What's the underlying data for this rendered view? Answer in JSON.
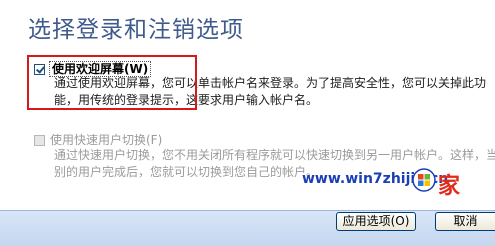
{
  "page": {
    "title": "选择登录和注销选项"
  },
  "options": {
    "welcome": {
      "label": "使用欢迎屏幕(W)",
      "checked": true,
      "enabled": true,
      "desc_line1": "通过使用欢迎屏幕，您可以单击帐户名来登录。为了提高安全性，您可以关掉此功",
      "desc_line2": "能，用传统的登录提示，这要求用户输入帐户名。"
    },
    "fast_switch": {
      "label": "使用快速用户切换(F)",
      "checked": false,
      "enabled": false,
      "desc_line1": "通过快速用户切换，您不用关闭所有程序就可以快速切换到另一用户帐户。这样，当",
      "desc_line2": "别的用户完成后，您就可以切换到您自己的帐户。"
    }
  },
  "watermark": {
    "text": "www.win7zhijia.cn",
    "home": "家"
  },
  "buttons": {
    "apply": "应用选项(O)",
    "cancel": "取消"
  },
  "colors": {
    "title": "#3f5a8c",
    "highlight": "#d51a1a",
    "watermark": "#1a3fb5"
  }
}
